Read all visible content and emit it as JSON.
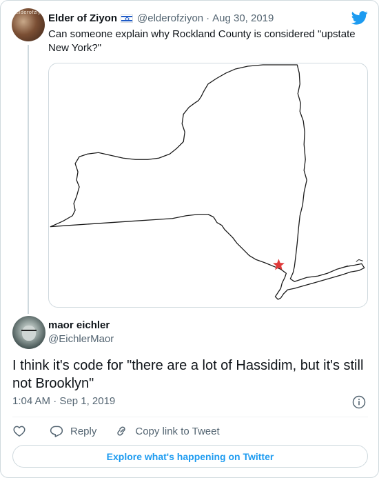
{
  "parent_tweet": {
    "author_name": "Elder of Ziyon",
    "avatar_text": "elderofziyon",
    "handle": "@elderofziyon",
    "separator": "·",
    "date": "Aug 30, 2019",
    "text": "Can someone explain why Rockland County is considered \"upstate New York?\""
  },
  "reply_tweet": {
    "author_name": "maor eichler",
    "handle": "@EichlerMaor",
    "text": "I think it's code for \"there are a lot of Hassidim, but it's still not Brooklyn\"",
    "timestamp": "1:04 AM · Sep 1, 2019"
  },
  "actions": {
    "reply_label": "Reply",
    "copy_label": "Copy link to Tweet"
  },
  "explore_label": "Explore what's happening on Twitter",
  "colors": {
    "accent": "#1d9bf0",
    "text_secondary": "#536471",
    "border": "#cfd9de",
    "marker": "#e03a3a"
  },
  "icons": {
    "brand": "twitter-bird-icon",
    "flag": "israel-flag-icon",
    "info": "info-icon",
    "like": "heart-icon",
    "reply": "reply-bubble-icon",
    "copy": "link-icon"
  }
}
